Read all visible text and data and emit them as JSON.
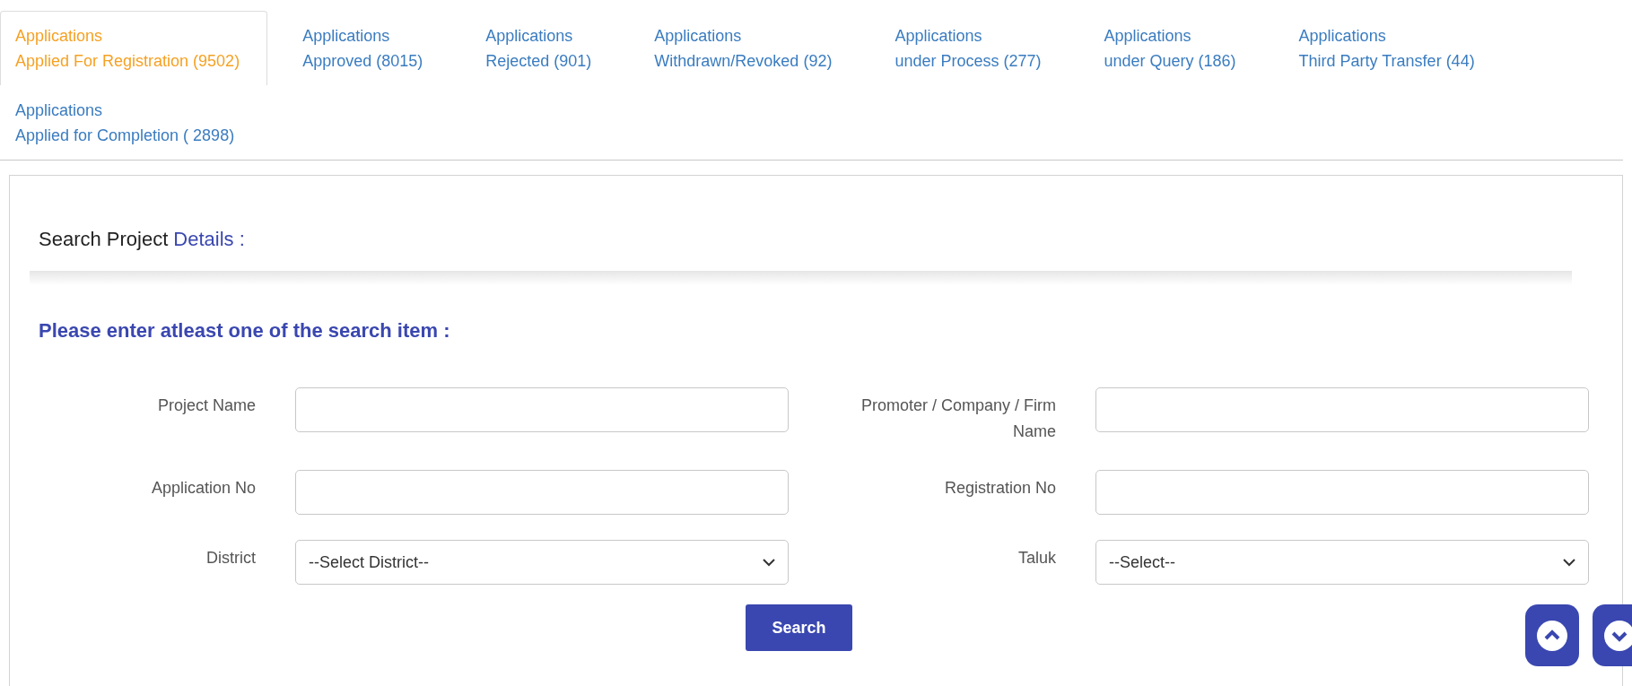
{
  "tabs": [
    {
      "line1": "Applications",
      "line2": "Applied For Registration (9502)",
      "selected": true
    },
    {
      "line1": "Applications",
      "line2": "Approved (8015)",
      "selected": false
    },
    {
      "line1": "Applications",
      "line2": "Rejected (901)",
      "selected": false
    },
    {
      "line1": "Applications",
      "line2": "Withdrawn/Revoked (92)",
      "selected": false
    },
    {
      "line1": "Applications",
      "line2": "under Process (277)",
      "selected": false
    },
    {
      "line1": "Applications",
      "line2": "under Query (186)",
      "selected": false
    },
    {
      "line1": "Applications",
      "line2": "Third Party Transfer (44)",
      "selected": false
    },
    {
      "line1": "Applications",
      "line2": "Applied for Completion ( 2898)",
      "selected": false
    }
  ],
  "panel": {
    "heading_lead": "Search Project",
    "heading_accent": "Details :",
    "instruction": "Please enter atleast one of the search item :",
    "fields": [
      {
        "label": "Project Name",
        "kind": "text"
      },
      {
        "label": "Promoter / Company / Firm Name",
        "kind": "text"
      },
      {
        "label": "Application No",
        "kind": "text"
      },
      {
        "label": "Registration No",
        "kind": "text"
      },
      {
        "label": "District",
        "kind": "select",
        "value": "--Select District--"
      },
      {
        "label": "Taluk",
        "kind": "select",
        "value": "--Select--"
      }
    ],
    "search_button": "Search"
  }
}
